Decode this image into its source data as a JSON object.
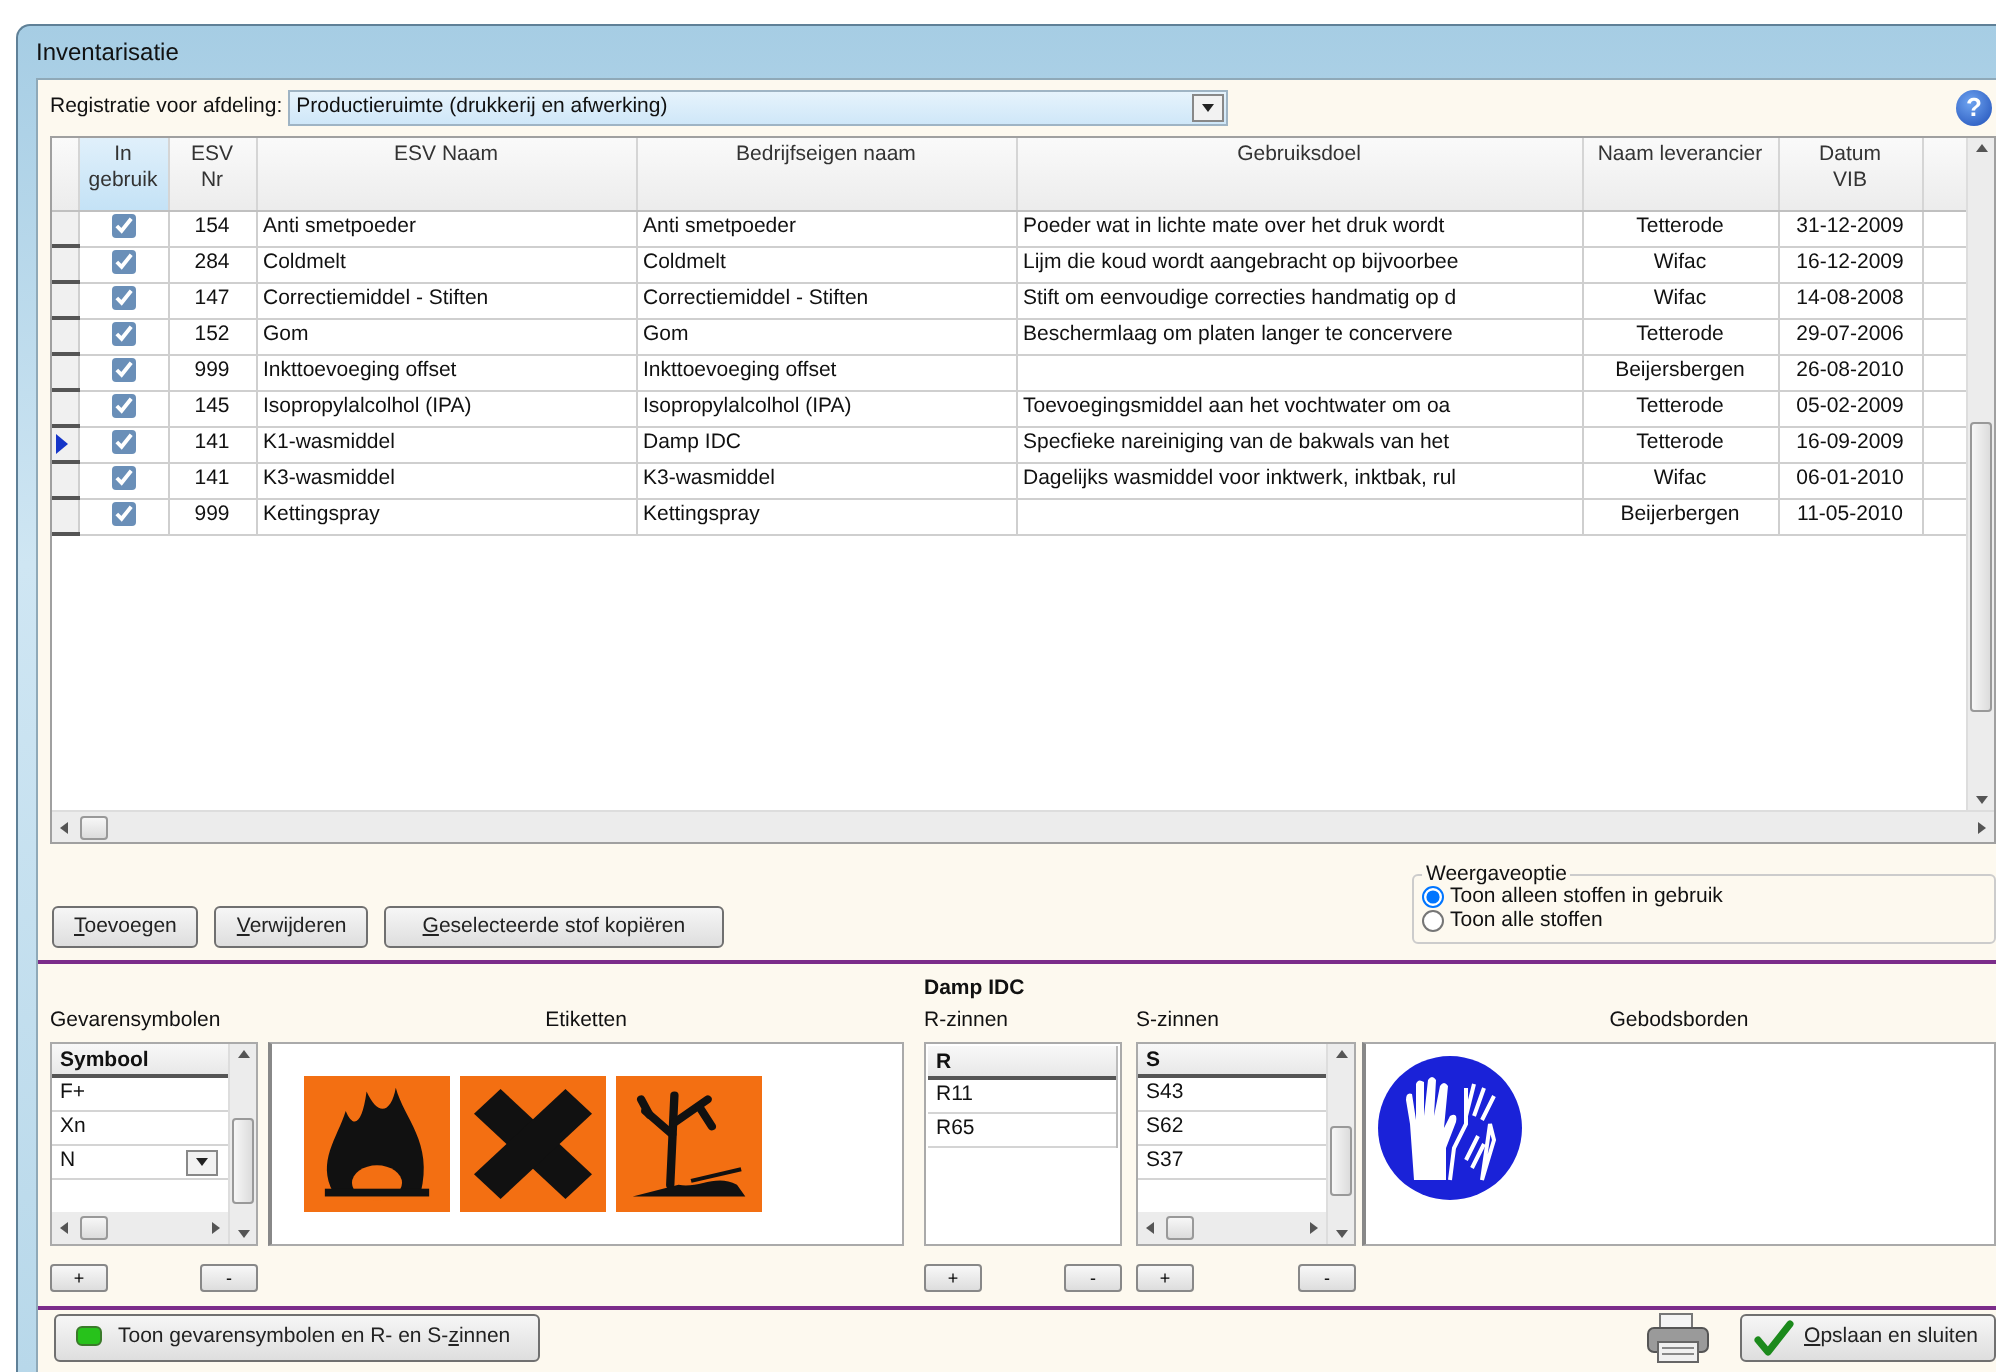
{
  "window": {
    "title": "Inventarisatie"
  },
  "department": {
    "label": "Registratie voor afdeling:",
    "value": "Productieruimte (drukkerij en afwerking)"
  },
  "help": "?",
  "table": {
    "columns": [
      {
        "lines": [
          "In",
          "gebruik"
        ],
        "highlighted": true
      },
      {
        "lines": [
          "ESV",
          "Nr"
        ],
        "highlighted": false
      },
      {
        "lines": [
          "ESV Naam"
        ],
        "highlighted": false
      },
      {
        "lines": [
          "Bedrijfseigen naam"
        ],
        "highlighted": false
      },
      {
        "lines": [
          "Gebruiksdoel"
        ],
        "highlighted": false
      },
      {
        "lines": [
          "Naam leverancier"
        ],
        "highlighted": false
      },
      {
        "lines": [
          "Datum",
          "VIB"
        ],
        "highlighted": false
      }
    ],
    "rows": [
      {
        "selected": false,
        "in_use": true,
        "nr": "154",
        "esv_name": "Anti smetpoeder",
        "company_name": "Anti smetpoeder",
        "purpose": "Poeder wat in lichte mate over het druk wordt",
        "supplier": "Tetterode",
        "date": "31-12-2009"
      },
      {
        "selected": false,
        "in_use": true,
        "nr": "284",
        "esv_name": "Coldmelt",
        "company_name": "Coldmelt",
        "purpose": "Lijm die koud wordt aangebracht op bijvoorbee",
        "supplier": "Wifac",
        "date": "16-12-2009"
      },
      {
        "selected": false,
        "in_use": true,
        "nr": "147",
        "esv_name": "Correctiemiddel - Stiften",
        "company_name": "Correctiemiddel - Stiften",
        "purpose": "Stift om eenvoudige correcties handmatig op d",
        "supplier": "Wifac",
        "date": "14-08-2008"
      },
      {
        "selected": false,
        "in_use": true,
        "nr": "152",
        "esv_name": "Gom",
        "company_name": "Gom",
        "purpose": "Beschermlaag om platen langer te concervere",
        "supplier": "Tetterode",
        "date": "29-07-2006"
      },
      {
        "selected": false,
        "in_use": true,
        "nr": "999",
        "esv_name": "Inkttoevoeging offset",
        "company_name": "Inkttoevoeging offset",
        "supplier": "Beijersbergen",
        "date": "26-08-2010"
      },
      {
        "selected": false,
        "in_use": true,
        "nr": "145",
        "esv_name": "Isopropylalcolhol (IPA)",
        "company_name": "Isopropylalcolhol (IPA)",
        "purpose": "Toevoegingsmiddel aan het vochtwater om oa",
        "supplier": "Tetterode",
        "date": "05-02-2009"
      },
      {
        "selected": true,
        "in_use": true,
        "nr": "141",
        "esv_name": "K1-wasmiddel",
        "company_name": "Damp IDC",
        "purpose": "Specfieke nareiniging van de bakwals van het",
        "supplier": "Tetterode",
        "date": "16-09-2009"
      },
      {
        "selected": false,
        "in_use": true,
        "nr": "141",
        "esv_name": "K3-wasmiddel",
        "company_name": "K3-wasmiddel",
        "purpose": "Dagelijks wasmiddel voor inktwerk, inktbak, rul",
        "supplier": "Wifac",
        "date": "06-01-2010"
      },
      {
        "selected": false,
        "in_use": true,
        "nr": "999",
        "esv_name": "Kettingspray",
        "company_name": "Kettingspray",
        "supplier": "Beijerbergen",
        "date": "11-05-2010"
      }
    ]
  },
  "actions": [
    {
      "label": [
        {
          "text": "T",
          "underlined": true
        },
        {
          "text": "oevoegen",
          "underlined": false
        }
      ]
    },
    {
      "label": [
        {
          "text": "V",
          "underlined": true
        },
        {
          "text": "erwijderen",
          "underlined": false
        }
      ]
    },
    {
      "label": [
        {
          "text": "G",
          "underlined": true
        },
        {
          "text": "eselecteerde stof kopiëren",
          "underlined": false
        }
      ]
    }
  ],
  "display_option": {
    "legend": "Weergaveoptie",
    "options": [
      {
        "label": "Toon alleen stoffen in gebruik",
        "selected": true
      },
      {
        "label": "Toon alle stoffen",
        "selected": false
      }
    ]
  },
  "hazard_symbols": {
    "title": "Gevarensymbolen",
    "column": "Symbool",
    "items": [
      {
        "text": "F+",
        "kind": "text"
      },
      {
        "text": "Xn",
        "kind": "text"
      },
      {
        "text": "N",
        "kind": "dropdown"
      }
    ],
    "buttons": [
      "+",
      "-"
    ]
  },
  "labels": {
    "title": "Etiketten",
    "pictograms": [
      {
        "kind": "flame"
      },
      {
        "kind": "cross"
      },
      {
        "kind": "tree"
      }
    ]
  },
  "substance": "Damp IDC",
  "r_phrases": {
    "title": "R-zinnen",
    "column": "R",
    "items": [
      "R11",
      "R65"
    ],
    "buttons": [
      "+",
      "-"
    ]
  },
  "s_phrases": {
    "title": "S-zinnen",
    "column": "S",
    "items": [
      "S43",
      "S62",
      "S37"
    ],
    "buttons": [
      "+",
      "-"
    ]
  },
  "mandatory_signs": {
    "title": "Gebodsborden",
    "signs": [
      {
        "kind": "gloves"
      }
    ]
  },
  "toggle_button": {
    "label": [
      {
        "text": "Toon gevarensymbolen en R- en S-",
        "underlined": false
      },
      {
        "text": "z",
        "underlined": true
      },
      {
        "text": "innen",
        "underlined": false
      }
    ],
    "on": true
  },
  "save_button": {
    "label": [
      {
        "text": "O",
        "underlined": true
      },
      {
        "text": "pslaan en sluiten",
        "underlined": false
      }
    ]
  }
}
